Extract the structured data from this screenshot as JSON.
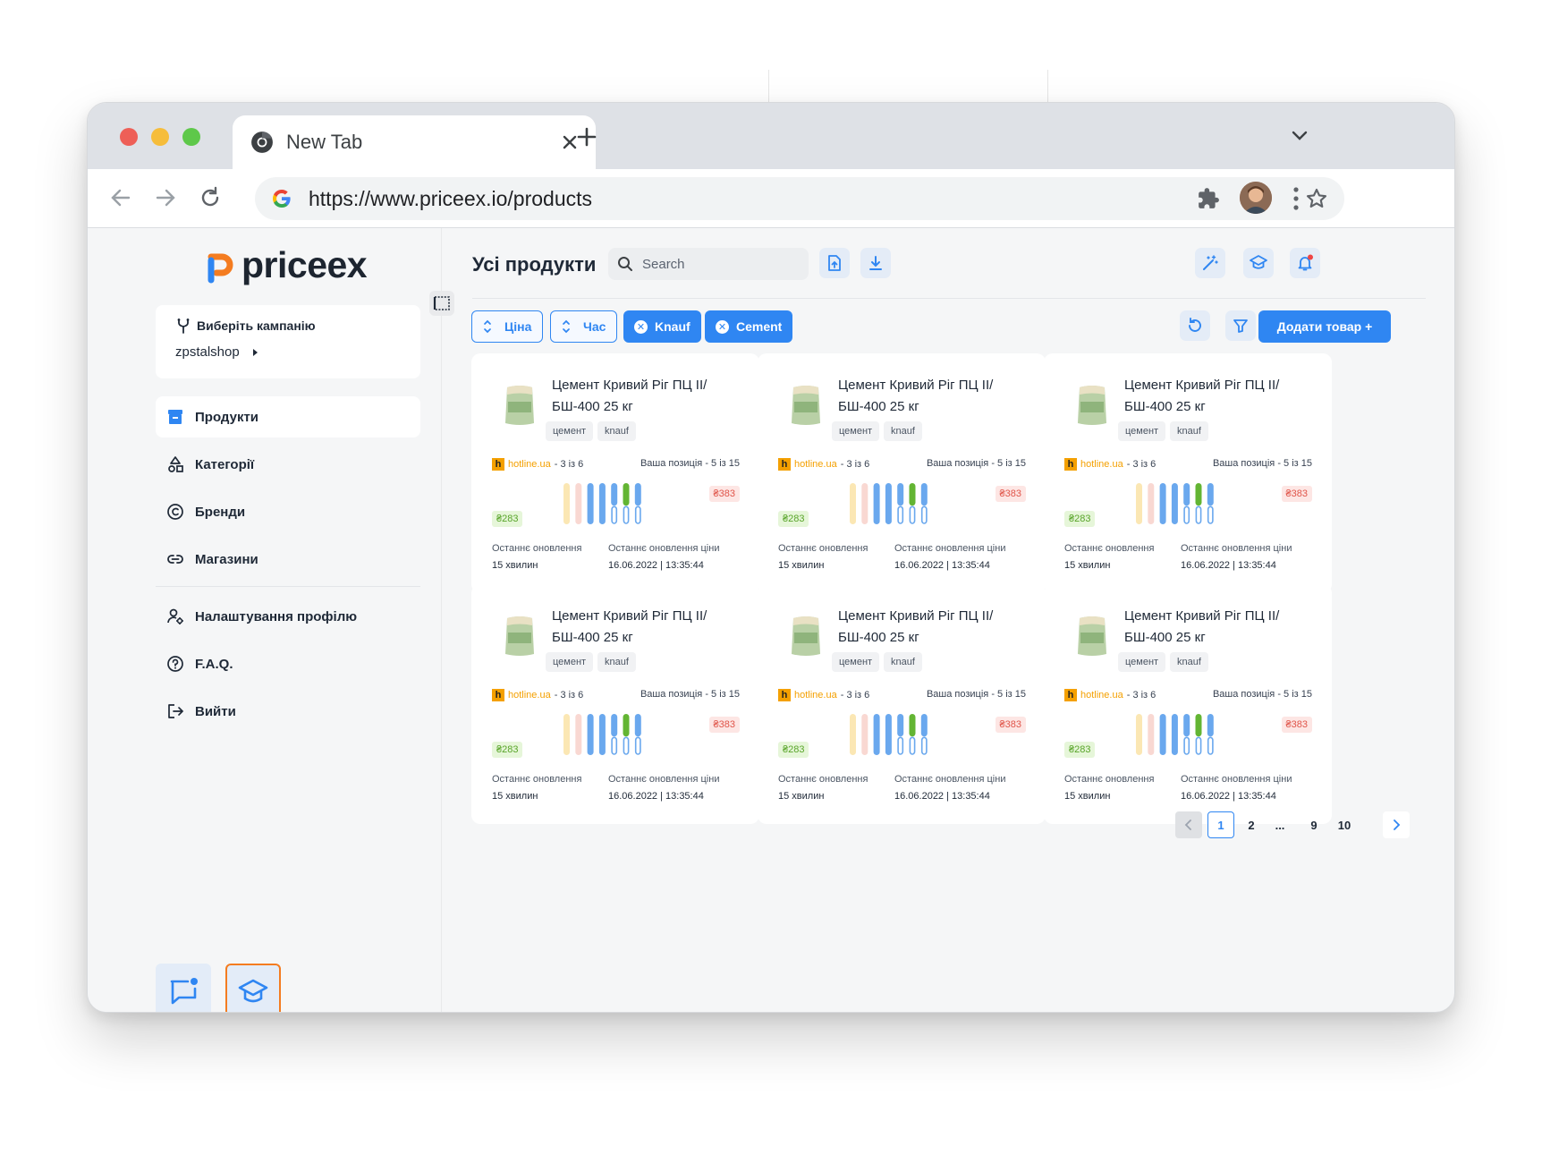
{
  "browser": {
    "tab_title": "New Tab",
    "url": "https://www.priceex.io/products"
  },
  "sidebar": {
    "logo_text": "priceex",
    "campaign_label": "Виберіть кампанію",
    "campaign_value": "zpstalshop",
    "items": [
      {
        "label": "Продукти",
        "icon": "box-icon",
        "active": true
      },
      {
        "label": "Категорії",
        "icon": "shapes-icon",
        "active": false
      },
      {
        "label": "Бренди",
        "icon": "copyright-icon",
        "active": false
      },
      {
        "label": "Магазини",
        "icon": "link-icon",
        "active": false
      },
      {
        "label": "Налаштування профілю",
        "icon": "user-settings-icon",
        "active": false
      },
      {
        "label": "F.A.Q.",
        "icon": "question-icon",
        "active": false
      },
      {
        "label": "Вийти",
        "icon": "logout-icon",
        "active": false
      }
    ]
  },
  "header": {
    "title": "Усі продукти",
    "search_placeholder": "Search"
  },
  "filters": {
    "sort_price": "Ціна",
    "sort_time": "Час",
    "chips": [
      "Knauf",
      "Cement"
    ],
    "add_button": "Додати товар +"
  },
  "products": [
    {
      "title": "Цемент Кривий Ріг ПЦ II/ БШ-400 25 кг",
      "tags": [
        "цемент",
        "knauf"
      ],
      "source": "hotline.ua",
      "source_rank": "- 3 із 6",
      "position": "Ваша позиція - 5 із 15",
      "price_low": "₴283",
      "price_high": "₴383",
      "updated_label": "Останнє оновлення",
      "updated_value": "15 хвилин",
      "price_updated_label": "Останнє оновлення ціни",
      "price_updated_value": "16.06.2022 | 13:35:44"
    },
    {
      "title": "Цемент Кривий Ріг ПЦ II/ БШ-400 25 кг",
      "tags": [
        "цемент",
        "knauf"
      ],
      "source": "hotline.ua",
      "source_rank": "- 3 із 6",
      "position": "Ваша позиція - 5 із 15",
      "price_low": "₴283",
      "price_high": "₴383",
      "updated_label": "Останнє оновлення",
      "updated_value": "15 хвилин",
      "price_updated_label": "Останнє оновлення ціни",
      "price_updated_value": "16.06.2022 | 13:35:44"
    },
    {
      "title": "Цемент Кривий Ріг ПЦ II/ БШ-400 25 кг",
      "tags": [
        "цемент",
        "knauf"
      ],
      "source": "hotline.ua",
      "source_rank": "- 3 із 6",
      "position": "Ваша позиція - 5 із 15",
      "price_low": "₴283",
      "price_high": "₴383",
      "updated_label": "Останнє оновлення",
      "updated_value": "15 хвилин",
      "price_updated_label": "Останнє оновлення ціни",
      "price_updated_value": "16.06.2022 | 13:35:44"
    },
    {
      "title": "Цемент Кривий Ріг ПЦ II/ БШ-400 25 кг",
      "tags": [
        "цемент",
        "knauf"
      ],
      "source": "hotline.ua",
      "source_rank": "- 3 із 6",
      "position": "Ваша позиція - 5 із 15",
      "price_low": "₴283",
      "price_high": "₴383",
      "updated_label": "Останнє оновлення",
      "updated_value": "15 хвилин",
      "price_updated_label": "Останнє оновлення ціни",
      "price_updated_value": "16.06.2022 | 13:35:44"
    },
    {
      "title": "Цемент Кривий Ріг ПЦ II/ БШ-400 25 кг",
      "tags": [
        "цемент",
        "knauf"
      ],
      "source": "hotline.ua",
      "source_rank": "- 3 із 6",
      "position": "Ваша позиція - 5 із 15",
      "price_low": "₴283",
      "price_high": "₴383",
      "updated_label": "Останнє оновлення",
      "updated_value": "15 хвилин",
      "price_updated_label": "Останнє оновлення ціни",
      "price_updated_value": "16.06.2022 | 13:35:44"
    },
    {
      "title": "Цемент Кривий Ріг ПЦ II/ БШ-400 25 кг",
      "tags": [
        "цемент",
        "knauf"
      ],
      "source": "hotline.ua",
      "source_rank": "- 3 із 6",
      "position": "Ваша позиція - 5 із 15",
      "price_low": "₴283",
      "price_high": "₴383",
      "updated_label": "Останнє оновлення",
      "updated_value": "15 хвилин",
      "price_updated_label": "Останнє оновлення ціни",
      "price_updated_value": "16.06.2022 | 13:35:44"
    }
  ],
  "price_bars": [
    {
      "color": "#fbe7b4",
      "fill": 1.0
    },
    {
      "color": "#f9d8d2",
      "fill": 1.0
    },
    {
      "color": "#6aa8ee",
      "fill": 1.0
    },
    {
      "color": "#6aa8ee",
      "fill": 1.0
    },
    {
      "color": "#6aa8ee",
      "fill": 0.55
    },
    {
      "color": "#63b533",
      "fill": 0.55
    },
    {
      "color": "#6aa8ee",
      "fill": 0.55
    }
  ],
  "pagination": [
    "1",
    "2",
    "...",
    "9",
    "10"
  ],
  "pagination_current": "1",
  "colors": {
    "accent": "#2f86f2",
    "danger": "#e0554a",
    "success": "#59a52a",
    "brand_orange": "#f47c20"
  }
}
